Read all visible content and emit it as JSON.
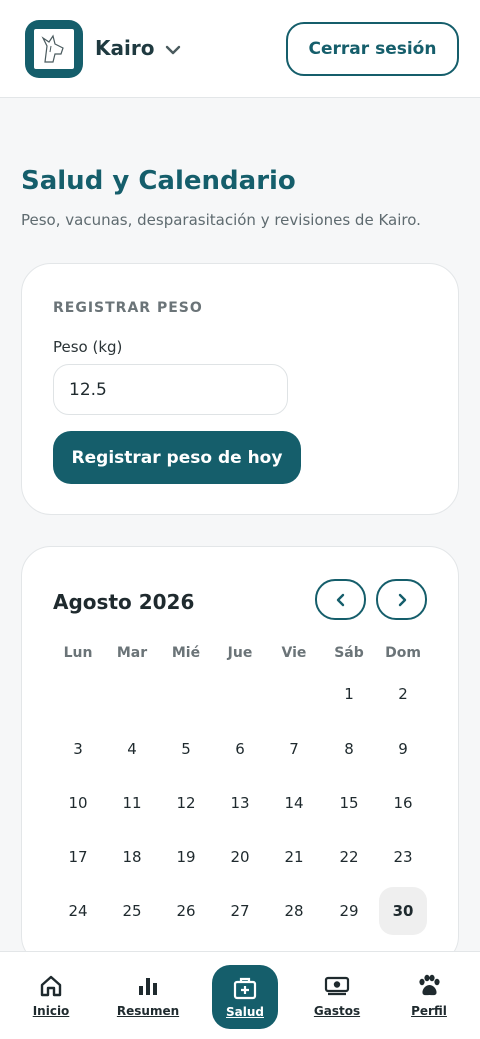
{
  "header": {
    "pet_name": "Kairo",
    "logout_label": "Cerrar sesión"
  },
  "page": {
    "title": "Salud y Calendario",
    "subtitle": "Peso, vacunas, desparasitación y revisiones de Kairo."
  },
  "weight_card": {
    "section_label": "REGISTRAR PESO",
    "field_label": "Peso (kg)",
    "field_value": "12.5",
    "submit_label": "Registrar peso de hoy"
  },
  "calendar": {
    "month_label": "Agosto 2026",
    "weekdays": [
      "Lun",
      "Mar",
      "Mié",
      "Jue",
      "Vie",
      "Sáb",
      "Dom"
    ],
    "weeks": [
      [
        "",
        "",
        "",
        "",
        "",
        "1",
        "2"
      ],
      [
        "3",
        "4",
        "5",
        "6",
        "7",
        "8",
        "9"
      ],
      [
        "10",
        "11",
        "12",
        "13",
        "14",
        "15",
        "16"
      ],
      [
        "17",
        "18",
        "19",
        "20",
        "21",
        "22",
        "23"
      ],
      [
        "24",
        "25",
        "26",
        "27",
        "28",
        "29",
        "30"
      ]
    ],
    "today": "30"
  },
  "bottom_nav": {
    "items": [
      {
        "label": "Inicio",
        "icon": "home-icon"
      },
      {
        "label": "Resumen",
        "icon": "bar-chart-icon"
      },
      {
        "label": "Salud",
        "icon": "medical-kit-icon"
      },
      {
        "label": "Gastos",
        "icon": "money-icon"
      },
      {
        "label": "Perfil",
        "icon": "paw-icon"
      }
    ],
    "active": "Salud"
  },
  "colors": {
    "accent": "#155e6b",
    "background": "#f6f7f8"
  }
}
